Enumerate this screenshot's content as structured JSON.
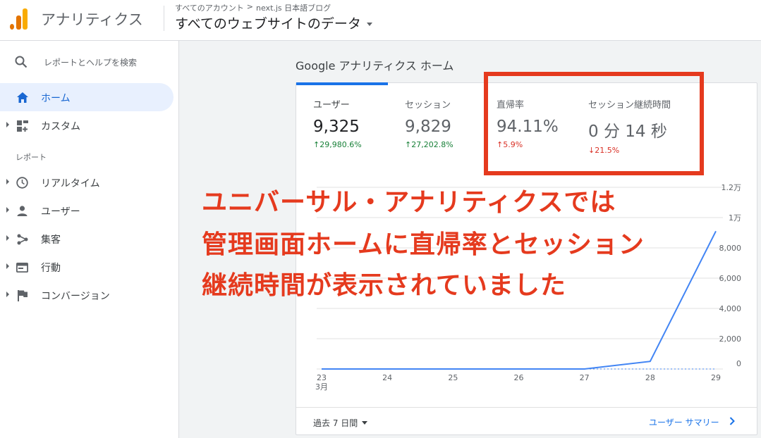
{
  "header": {
    "app_title": "アナリティクス",
    "breadcrumb": {
      "account": "すべてのアカウント",
      "separator": ">",
      "property": "next.js 日本語ブログ"
    },
    "view": "すべてのウェブサイトのデータ"
  },
  "sidebar": {
    "search_placeholder": "レポートとヘルプを検索",
    "items_top": [
      {
        "label": "ホーム",
        "icon": "home-icon",
        "active": true
      },
      {
        "label": "カスタム",
        "icon": "dashboard-icon",
        "active": false
      }
    ],
    "section_label": "レポート",
    "items_reports": [
      {
        "label": "リアルタイム",
        "icon": "clock-icon"
      },
      {
        "label": "ユーザー",
        "icon": "person-icon"
      },
      {
        "label": "集客",
        "icon": "acquisition-icon"
      },
      {
        "label": "行動",
        "icon": "behavior-icon"
      },
      {
        "label": "コンバージョン",
        "icon": "flag-icon"
      }
    ]
  },
  "main": {
    "page_title": "Google アナリティクス ホーム",
    "metrics": [
      {
        "label": "ユーザー",
        "value": "9,325",
        "change": "↑29,980.6%",
        "direction": "up"
      },
      {
        "label": "セッション",
        "value": "9,829",
        "change": "↑27,202.8%",
        "direction": "up"
      },
      {
        "label": "直帰率",
        "value": "94.11%",
        "change": "↑5.9%",
        "direction": "up-bad"
      },
      {
        "label": "セッション継続時間",
        "value": "0 分 14 秒",
        "change": "↓21.5%",
        "direction": "down-bad"
      }
    ],
    "date_range": "過去 7 日間",
    "summary_link": "ユーザー サマリー"
  },
  "annotation": {
    "lines": [
      "ユニバーサル・アナリティクスでは",
      "管理画面ホームに直帰率とセッション",
      "継続時間が表示されていました"
    ]
  },
  "colors": {
    "accent": "#1a73e8",
    "annotation": "#e53a1e",
    "up": "#188038",
    "down": "#d93025"
  },
  "chart_data": {
    "type": "line",
    "categories": [
      "23",
      "24",
      "25",
      "26",
      "27",
      "28",
      "29"
    ],
    "x_sublabel": "3月",
    "series": [
      {
        "values": [
          0,
          0,
          0,
          0,
          0,
          500,
          9100
        ],
        "style": "solid"
      },
      {
        "values": [
          0,
          0,
          0,
          0,
          0,
          0,
          0
        ],
        "style": "dashed"
      }
    ],
    "y_ticks": [
      "0",
      "2,000",
      "4,000",
      "6,000",
      "8,000",
      "1万",
      "1.2万"
    ],
    "ylim": [
      0,
      12000
    ],
    "grid": true
  }
}
